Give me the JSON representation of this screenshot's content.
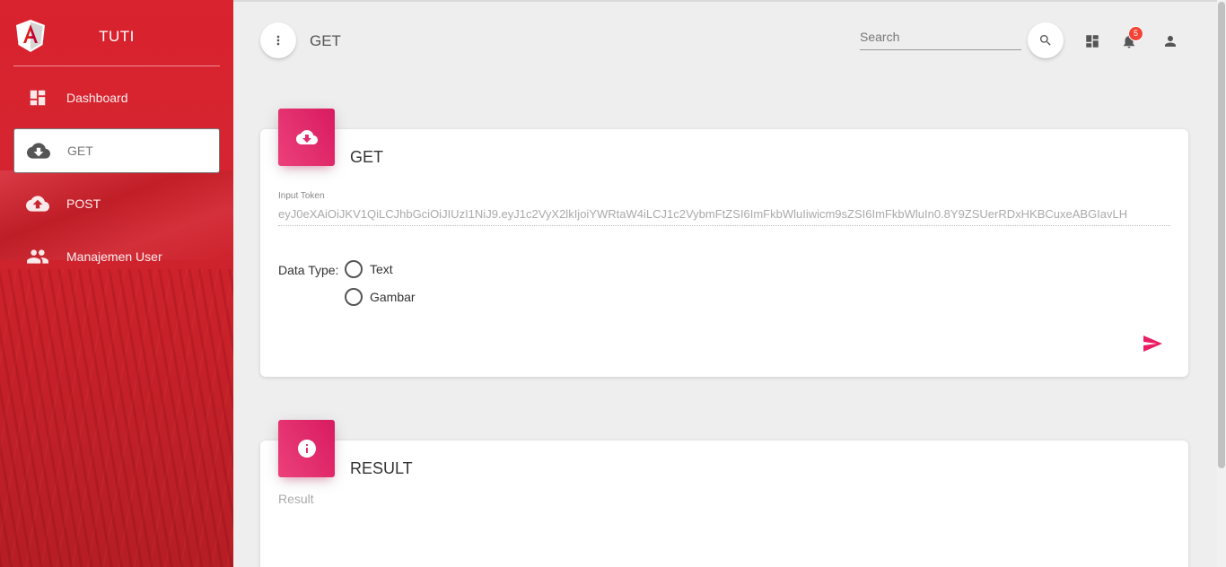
{
  "app": {
    "brand": "TUTI",
    "page_title": "GET"
  },
  "sidebar": {
    "items": [
      {
        "label": "Dashboard",
        "icon": "dashboard-icon",
        "active": false
      },
      {
        "label": "GET",
        "icon": "cloud-download-icon",
        "active": true
      },
      {
        "label": "POST",
        "icon": "cloud-upload-icon",
        "active": false
      },
      {
        "label": "Manajemen User",
        "icon": "people-icon",
        "active": false
      }
    ]
  },
  "topbar": {
    "search_placeholder": "Search",
    "notification_count": "5"
  },
  "get_card": {
    "title": "GET",
    "token_label": "Input Token",
    "token_value": "eyJ0eXAiOiJKV1QiLCJhbGciOiJIUzI1NiJ9.eyJ1c2VyX2lkIjoiYWRtaW4iLCJ1c2VybmFtZSI6ImFkbWluIiwicm9sZSI6ImFkbWluIn0.8Y9ZSUerRDxHKBCuxeABGIavLH",
    "data_type_label": "Data Type:",
    "options": [
      "Text",
      "Gambar"
    ]
  },
  "result_card": {
    "title": "RESULT",
    "placeholder": "Result"
  },
  "colors": {
    "sidebar_red": "#d9232e",
    "accent_pink": "#e91e63",
    "badge_red": "#f44336"
  }
}
